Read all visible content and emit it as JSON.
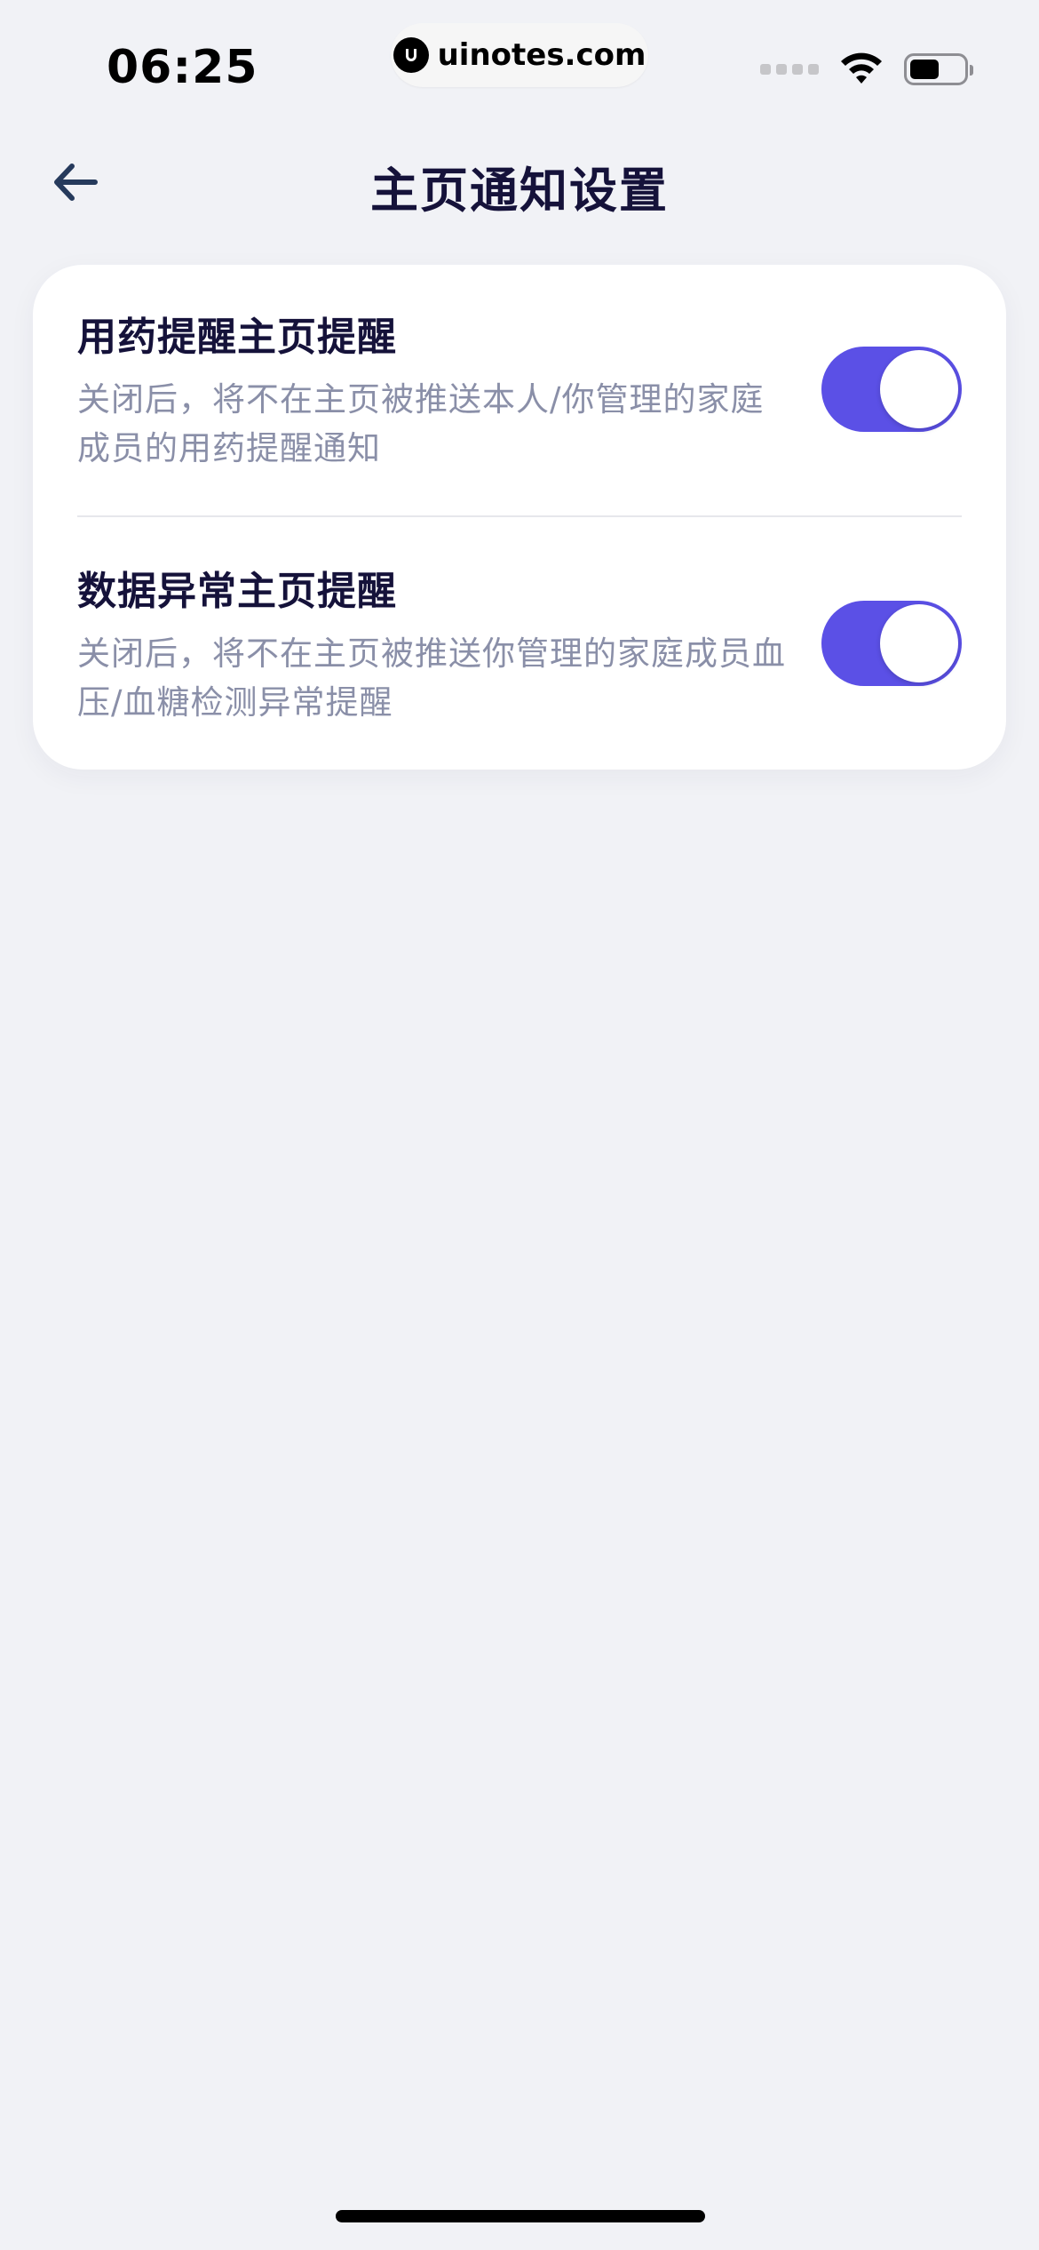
{
  "status_bar": {
    "time": "06:25",
    "watermark": "uinotes.com",
    "icons": [
      "signal-icon",
      "wifi-icon",
      "battery-icon"
    ],
    "battery_level": 0.5
  },
  "nav": {
    "back_icon": "arrow-left-icon",
    "title": "主页通知设置"
  },
  "settings": [
    {
      "title": "用药提醒主页提醒",
      "description": "关闭后，将不在主页被推送本人/你管理的家庭成员的用药提醒通知",
      "enabled": true
    },
    {
      "title": "数据异常主页提醒",
      "description": "关闭后，将不在主页被推送你管理的家庭成员血压/血糖检测异常提醒",
      "enabled": true
    }
  ],
  "colors": {
    "accent": "#5b50e6",
    "background": "#f1f2f6",
    "card": "#ffffff",
    "title_text": "#15123a",
    "secondary_text": "#8a8fa8"
  }
}
